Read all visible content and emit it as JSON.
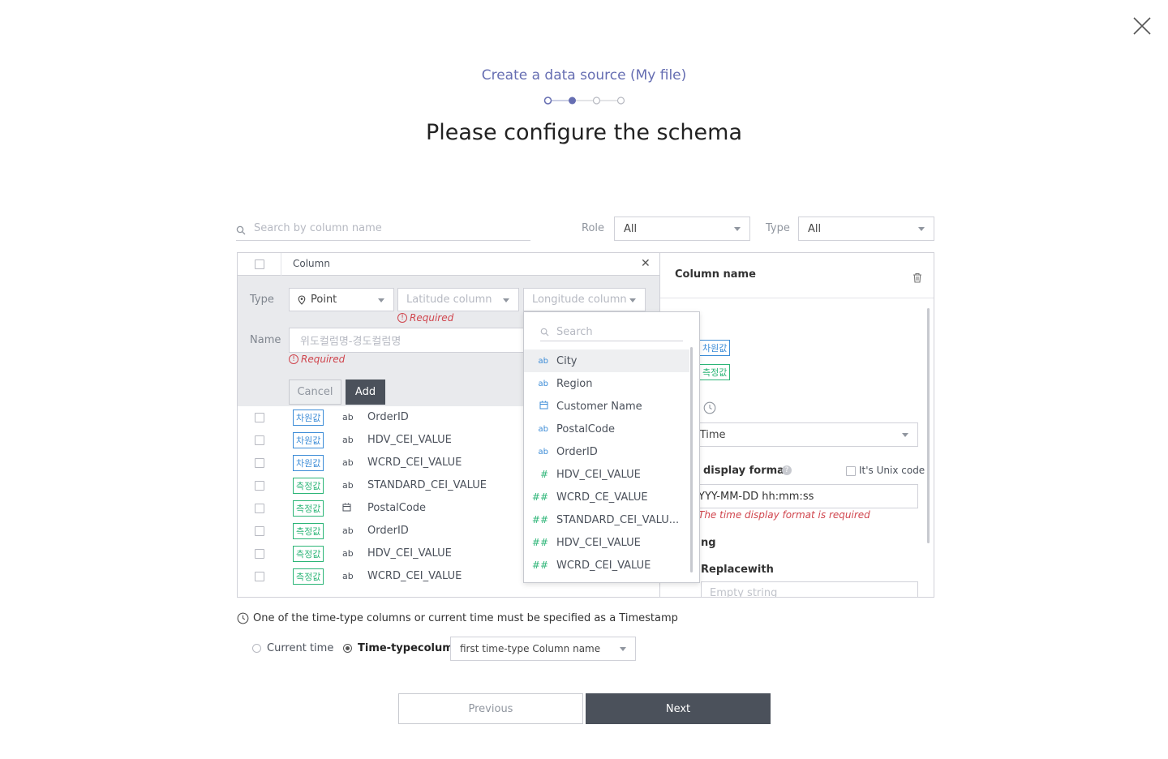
{
  "modal": {
    "title": "Create a data source (My file)",
    "heading": "Please configure the schema",
    "steps": {
      "total": 4,
      "current": 2
    }
  },
  "filters": {
    "search_placeholder": "Search by column name",
    "role_label": "Role",
    "role_value": "All",
    "type_label": "Type",
    "type_value": "All"
  },
  "table": {
    "column_header": "Column",
    "editor": {
      "type_label": "Type",
      "type_value": "Point",
      "latitude_placeholder": "Latitude column",
      "longitude_placeholder": "Longitude column",
      "required_text": "Required",
      "name_label": "Name",
      "name_placeholder": "위도컬럼명-경도컬럼명",
      "cancel_label": "Cancel",
      "add_label": "Add"
    },
    "rows": [
      {
        "role": "차원값",
        "role_kind": "dimension",
        "type_icon": "ab",
        "name": "OrderID"
      },
      {
        "role": "차원값",
        "role_kind": "dimension",
        "type_icon": "ab",
        "name": "HDV_CEI_VALUE"
      },
      {
        "role": "차원값",
        "role_kind": "dimension",
        "type_icon": "ab",
        "name": "WCRD_CEI_VALUE"
      },
      {
        "role": "측정값",
        "role_kind": "measure",
        "type_icon": "ab",
        "name": "STANDARD_CEI_VALUE"
      },
      {
        "role": "측정값",
        "role_kind": "measure",
        "type_icon": "calendar",
        "name": "PostalCode"
      },
      {
        "role": "측정값",
        "role_kind": "measure",
        "type_icon": "ab",
        "name": "OrderID"
      },
      {
        "role": "측정값",
        "role_kind": "measure",
        "type_icon": "ab",
        "name": "HDV_CEI_VALUE"
      },
      {
        "role": "측정값",
        "role_kind": "measure",
        "type_icon": "ab",
        "name": "WCRD_CEI_VALUE"
      }
    ]
  },
  "dropdown": {
    "search_placeholder": "Search",
    "items": [
      {
        "icon": "ab",
        "label": "City",
        "highlighted": true
      },
      {
        "icon": "ab",
        "label": "Region"
      },
      {
        "icon": "calendar",
        "label": "Customer Name"
      },
      {
        "icon": "ab",
        "label": "PostalCode"
      },
      {
        "icon": "ab",
        "label": "OrderID"
      },
      {
        "icon": "#",
        "label": "HDV_CEI_VALUE"
      },
      {
        "icon": "##",
        "label": "WCRD_CE_VALUE"
      },
      {
        "icon": "##",
        "label": "STANDARD_CEI_VALU..."
      },
      {
        "icon": "##",
        "label": "HDV_CEI_VALUE"
      },
      {
        "icon": "##",
        "label": "WCRD_CEI_VALUE"
      }
    ]
  },
  "detail": {
    "title": "Column name",
    "badge_dim": "차원값",
    "badge_meas": "측정값",
    "time_select_value": "l Time",
    "format_label": "display format",
    "unix_label": "It's Unix code",
    "format_value": "YYY-MM-DD hh:mm:ss",
    "format_error": "The time display format is required",
    "section_partial": "ng",
    "replace_label": "Replacewith",
    "replace_placeholder": "Empty string"
  },
  "timestamp": {
    "note": "One of the time-type columns or current time must be specified as a Timestamp",
    "option_current": "Current time",
    "option_time_column": "Time-typecolumn",
    "column_select_value": "first time-type Column name",
    "selected": "time_column"
  },
  "footer": {
    "previous_label": "Previous",
    "next_label": "Next"
  },
  "colors": {
    "accent": "#666eb2",
    "dimension": "#3c8cd7",
    "measure": "#2cb577",
    "error": "#d0454d",
    "dark_button": "#4b515b"
  }
}
